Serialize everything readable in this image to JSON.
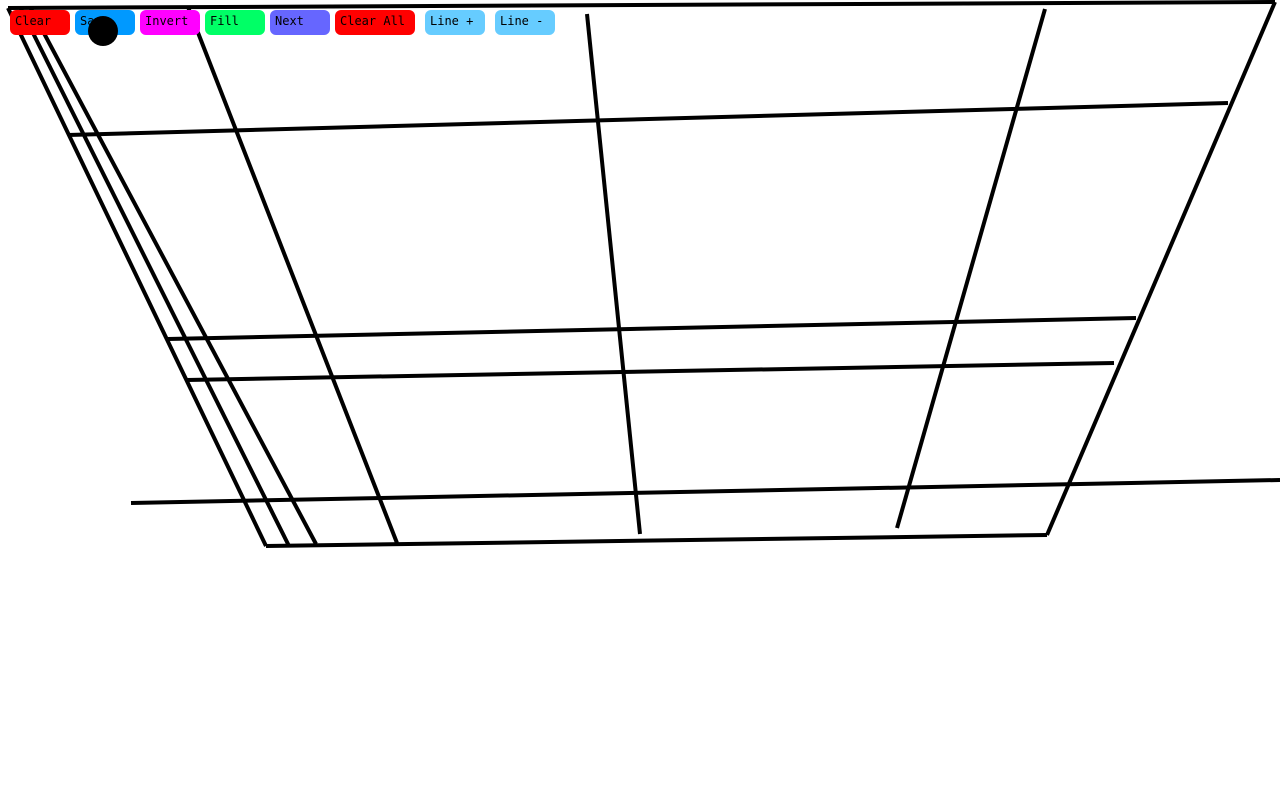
{
  "toolbar": {
    "buttons": [
      {
        "label": "Clear",
        "color": "#ff0000"
      },
      {
        "label": "Save",
        "color": "#0099ff"
      },
      {
        "label": "Invert",
        "color": "#ff00ff"
      },
      {
        "label": "Fill",
        "color": "#00ff66"
      },
      {
        "label": "Next",
        "color": "#6666ff"
      },
      {
        "label": "Clear All",
        "color": "#ff0000"
      },
      {
        "label": "Line +",
        "color": "#66ccff"
      },
      {
        "label": "Line -",
        "color": "#66ccff"
      }
    ]
  },
  "canvas": {
    "background": "#ffffff",
    "stroke_color": "#000000"
  },
  "cursor": {
    "color": "#000000"
  }
}
